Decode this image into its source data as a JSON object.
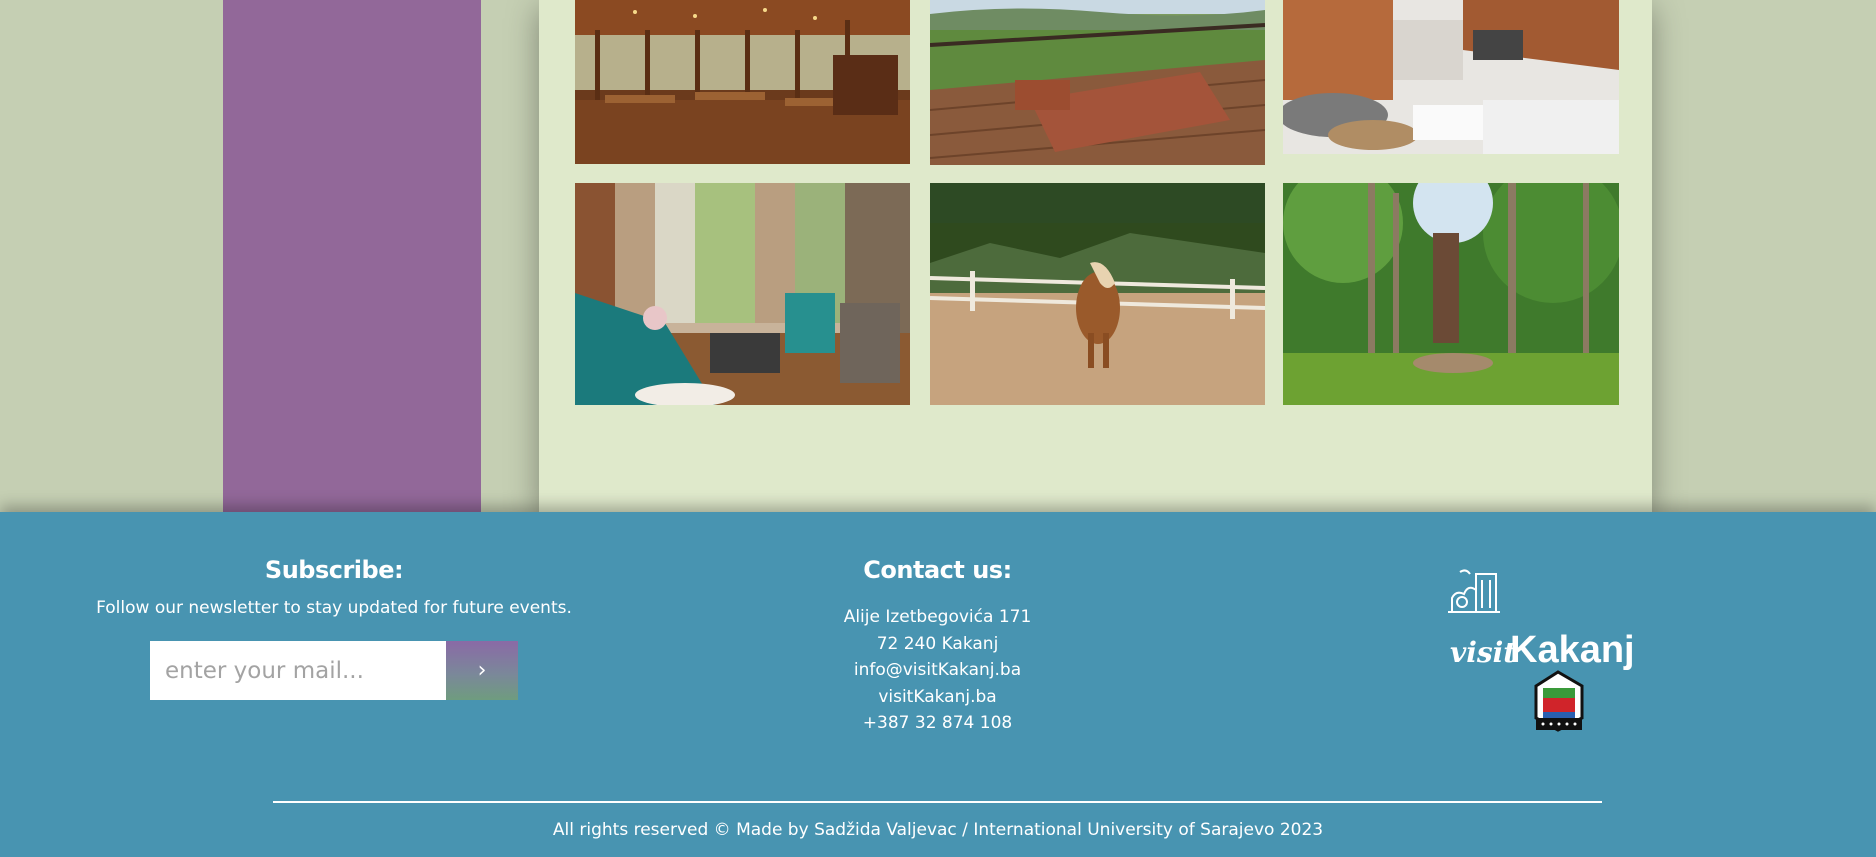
{
  "gallery": {
    "images": [
      {
        "name": "restaurant-interior-photo"
      },
      {
        "name": "terrace-view-photo"
      },
      {
        "name": "chalet-living-room-photo"
      },
      {
        "name": "lounge-sofa-photo"
      },
      {
        "name": "horse-paddock-photo"
      },
      {
        "name": "forest-treehouse-photo"
      }
    ]
  },
  "footer": {
    "subscribe": {
      "title": "Subscribe:",
      "text": "Follow our newsletter to stay updated for future events.",
      "placeholder": "enter your mail...",
      "button_icon": "chevron-right-icon",
      "button_glyph": "›"
    },
    "contact": {
      "title": "Contact us:",
      "lines": [
        "Alije Izetbegovića 171",
        "72 240 Kakanj",
        "info@visitKakanj.ba",
        "visitKakanj.ba",
        "+387 32 874 108"
      ]
    },
    "brand": {
      "logo_prefix": "visit",
      "logo_name": "Kakanj",
      "icon": "city-building-icon",
      "emblem": "municipality-coat-of-arms"
    },
    "copyright": "All rights reserved © Made by Sadžida Valjevac / International University of Sarajevo 2023"
  },
  "colors": {
    "page_bg": "#c5cfb3",
    "sidebar": "#926899",
    "panel": "#dfe9cb",
    "footer": "#4894b1",
    "text": "#ffffff"
  }
}
